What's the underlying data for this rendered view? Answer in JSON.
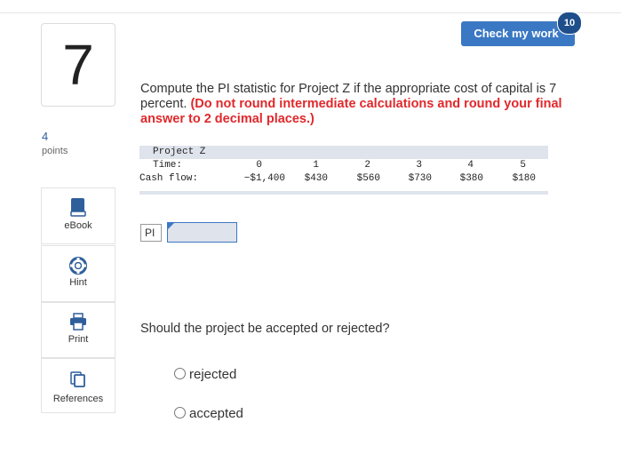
{
  "question": {
    "number": "7",
    "points_value": "4",
    "points_label": "points",
    "text": "Compute the PI statistic for Project Z if the appropriate cost of capital is 7 percent.",
    "instruction": "(Do not round intermediate calculations and round your final answer to 2 decimal places.)",
    "followup": "Should the project be accepted or rejected?"
  },
  "header": {
    "check_button": "Check my work",
    "badge_count": "10"
  },
  "sidebar": {
    "ebook": "eBook",
    "hint": "Hint",
    "print": "Print",
    "references": "References"
  },
  "table": {
    "title": "Project Z",
    "time_label": "Time:",
    "cash_label": "Cash flow:",
    "times": [
      "0",
      "1",
      "2",
      "3",
      "4",
      "5"
    ],
    "cash_flows": [
      "−$1,400",
      "$430",
      "$560",
      "$730",
      "$380",
      "$180"
    ]
  },
  "answer": {
    "label": "PI",
    "value": ""
  },
  "options": [
    {
      "label": "rejected"
    },
    {
      "label": "accepted"
    }
  ],
  "colors": {
    "accent": "#3b78c4",
    "badge": "#1f4f8a",
    "warning_red": "#e0282b",
    "table_band": "#dfe3ec"
  }
}
